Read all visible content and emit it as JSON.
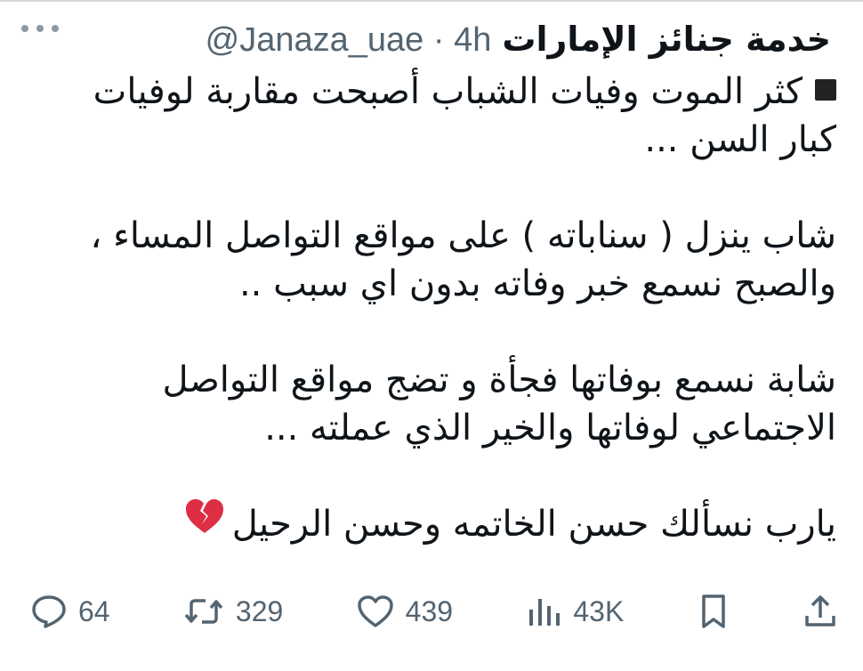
{
  "tweet": {
    "author_name": "خدمة جنائز الإمارات",
    "handle": "@Janaza_uae",
    "separator": "·",
    "time": "4h",
    "paragraphs": [
      [
        "كثر الموت وفيات الشباب أصبحت مقاربة لوفيات",
        "كبار السن ..."
      ],
      [
        "شاب ينزل ( سناباته ) على مواقع التواصل المساء ،",
        "والصبح نسمع خبر وفاته بدون اي سبب .."
      ],
      [
        "شابة نسمع بوفاتها فجأة و تضج مواقع التواصل",
        "الاجتماعي لوفاتها والخير الذي عملته ..."
      ],
      [
        "يارب نسألك حسن الخاتمه وحسن الرحيل"
      ]
    ],
    "emoji": "broken-heart"
  },
  "actions": {
    "replies": "64",
    "reposts": "329",
    "likes": "439",
    "views": "43K"
  },
  "icons": {
    "more": "more-dots-icon",
    "reply": "reply-bubble-icon",
    "repost": "repost-icon",
    "like": "heart-outline-icon",
    "views": "views-bar-chart-icon",
    "bookmark": "bookmark-icon",
    "share": "share-upload-icon"
  },
  "colors": {
    "text": "#0f1419",
    "secondary": "#536471",
    "emoji_red": "#dd2e44"
  }
}
